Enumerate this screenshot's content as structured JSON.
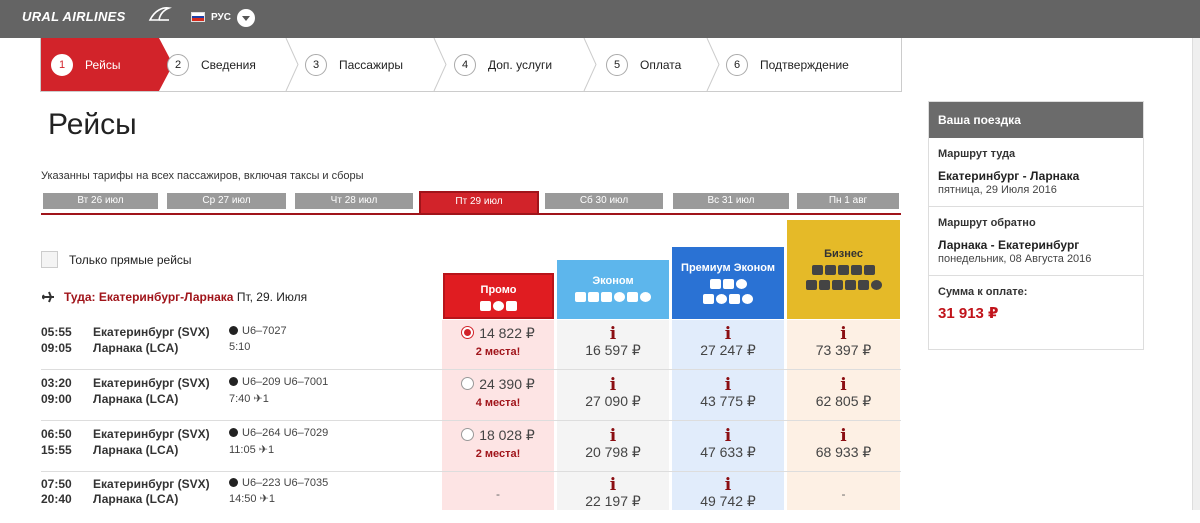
{
  "header": {
    "brand": "URAL AIRLINES",
    "language": "РУС"
  },
  "steps": [
    {
      "num": "1",
      "label": "Рейсы"
    },
    {
      "num": "2",
      "label": "Сведения"
    },
    {
      "num": "3",
      "label": "Пассажиры"
    },
    {
      "num": "4",
      "label": "Доп. услуги"
    },
    {
      "num": "5",
      "label": "Оплата"
    },
    {
      "num": "6",
      "label": "Подтверждение"
    }
  ],
  "page_title": "Рейсы",
  "fare_note": "Указанны тарифы на всех пассажиров, включая таксы и сборы",
  "dates": [
    "Вт 26 июл",
    "Ср 27 июл",
    "Чт 28 июл",
    "Пт 29 июл",
    "Сб 30 июл",
    "Вс 31 июл",
    "Пн 1 авг"
  ],
  "direct_only_label": "Только прямые рейсы",
  "route": {
    "label": "Туда: Екатеринбург-Ларнака",
    "date": "Пт, 29. Июля"
  },
  "fare_classes": [
    {
      "name": "Промо",
      "color": "#e01c21"
    },
    {
      "name": "Эконом",
      "color": "#5db6ec"
    },
    {
      "name": "Премиум Эконом",
      "color": "#2a72d4"
    },
    {
      "name": "Бизнес",
      "color": "#e5ba28"
    }
  ],
  "flights": [
    {
      "dep_time": "05:55",
      "arr_time": "09:05",
      "from": "Екатеринбург (SVX)",
      "to": "Ларнака (LCA)",
      "flights": "U6–7027",
      "duration": "5:10",
      "stops": "",
      "promo": "14 822 ₽",
      "promo_seats": "2 места!",
      "economy": "16 597 ₽",
      "premium": "27 247 ₽",
      "business": "73 397 ₽"
    },
    {
      "dep_time": "03:20",
      "arr_time": "09:00",
      "from": "Екатеринбург (SVX)",
      "to": "Ларнака (LCA)",
      "flights": "U6–209  U6–7001",
      "duration": "7:40",
      "stops": "1",
      "promo": "24 390 ₽",
      "promo_seats": "4 места!",
      "economy": "27 090 ₽",
      "premium": "43 775 ₽",
      "business": "62 805 ₽"
    },
    {
      "dep_time": "06:50",
      "arr_time": "15:55",
      "from": "Екатеринбург (SVX)",
      "to": "Ларнака (LCA)",
      "flights": "U6–264  U6–7029",
      "duration": "11:05",
      "stops": "1",
      "promo": "18 028 ₽",
      "promo_seats": "2 места!",
      "economy": "20 798 ₽",
      "premium": "47 633 ₽",
      "business": "68 933 ₽"
    },
    {
      "dep_time": "07:50",
      "arr_time": "20:40",
      "from": "Екатеринбург (SVX)",
      "to": "Ларнака (LCA)",
      "flights": "U6–223  U6–7035",
      "duration": "14:50",
      "stops": "1",
      "promo": "-",
      "promo_seats": "",
      "economy": "22 197 ₽",
      "premium": "49 742 ₽",
      "business": "-"
    }
  ],
  "summary": {
    "title": "Ваша поездка",
    "outbound_label": "Маршрут туда",
    "outbound_route": "Екатеринбург - Ларнака",
    "outbound_date": "пятница, 29 Июля 2016",
    "return_label": "Маршрут обратно",
    "return_route": "Ларнака - Екатеринбург",
    "return_date": "понедельник, 08 Августа 2016",
    "total_label": "Сумма к оплате:",
    "total": "31 913 ₽"
  },
  "colors": {
    "accent": "#d2232a",
    "accent_dark": "#a0141a",
    "topbar": "#646464"
  }
}
